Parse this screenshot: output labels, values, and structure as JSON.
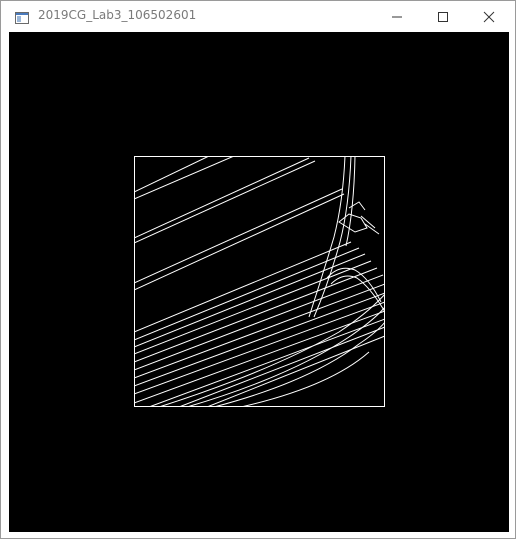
{
  "window": {
    "title": "2019CG_Lab3_106502601",
    "icons": {
      "app": "app-window-icon",
      "minimize": "minimize-icon",
      "maximize": "maximize-icon",
      "close": "close-icon"
    }
  },
  "colors": {
    "titlebar_bg": "#ffffff",
    "title_text": "#7a7a7a",
    "client_bg": "#000000",
    "stroke": "#ffffff"
  }
}
